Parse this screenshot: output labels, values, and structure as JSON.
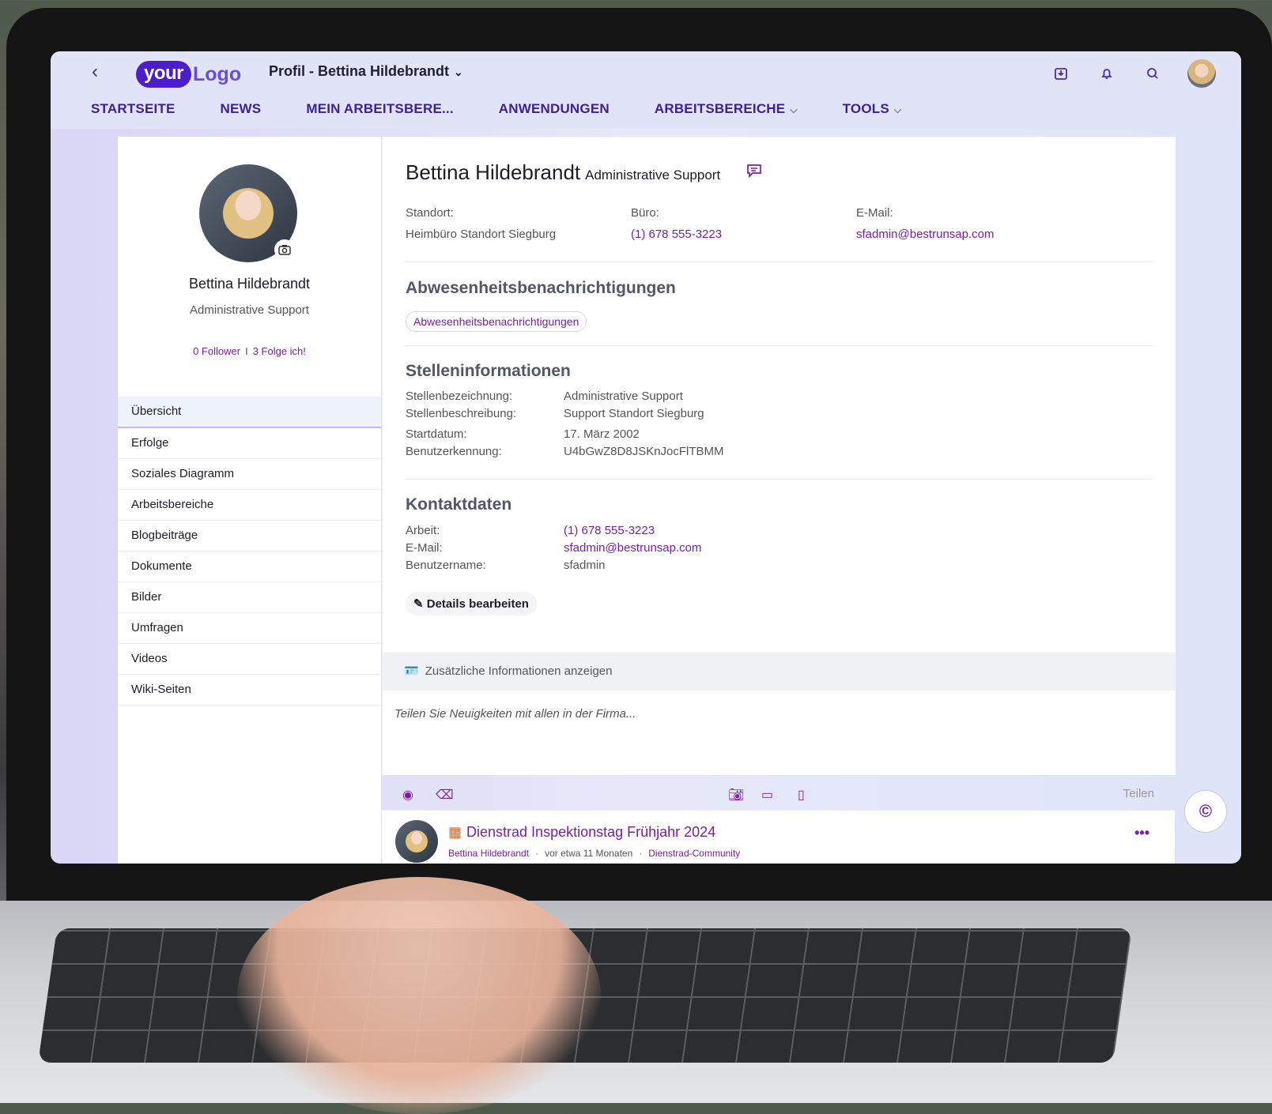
{
  "header": {
    "back_label": "‹",
    "logo_your": "your",
    "logo_text": "Logo",
    "page_title": "Profil - Bettina Hildebrandt",
    "icons": [
      "inbox-download-icon",
      "bell-icon",
      "search-icon",
      "user-avatar"
    ]
  },
  "nav": {
    "items": [
      {
        "label": "STARTSEITE",
        "has_dropdown": false
      },
      {
        "label": "NEWS",
        "has_dropdown": false
      },
      {
        "label": "MEIN ARBEITSBERE...",
        "has_dropdown": false
      },
      {
        "label": "ANWENDUNGEN",
        "has_dropdown": false
      },
      {
        "label": "ARBEITSBEREICHE",
        "has_dropdown": true
      },
      {
        "label": "TOOLS",
        "has_dropdown": true
      }
    ]
  },
  "profile_sidebar": {
    "name": "Bettina Hildebrandt",
    "role": "Administrative Support",
    "followers": "0 Follower",
    "separator": "I",
    "following": "3 Folge ich!",
    "menu": [
      "Übersicht",
      "Erfolge",
      "Soziales Diagramm",
      "Arbeitsbereiche",
      "Blogbeiträge",
      "Dokumente",
      "Bilder",
      "Umfragen",
      "Videos",
      "Wiki-Seiten"
    ],
    "active_item": "Übersicht"
  },
  "profile_main": {
    "name": "Bettina Hildebrandt",
    "role": "Administrative Support",
    "location_label": "Standort:",
    "location_value": "Heimbüro Standort Siegburg",
    "office_label": "Büro:",
    "office_value": "(1) 678 555-3223",
    "email_label": "E-Mail:",
    "email_value": "sfadmin@bestrunsap.com",
    "absence": {
      "heading": "Abwesenheitsbenachrichtigungen",
      "chip": "Abwesenheitsbenachrichtigungen"
    },
    "job": {
      "heading": "Stelleninformationen",
      "rows": [
        {
          "k": "Stellenbezeichnung:",
          "v": "Administrative Support"
        },
        {
          "k": "Stellenbeschreibung:",
          "v": "Support Standort Siegburg"
        },
        {
          "k": "Startdatum:",
          "v": "17. März 2002"
        },
        {
          "k": "Benutzerkennung:",
          "v": "U4bGwZ8D8JSKnJocFlTBMM"
        }
      ]
    },
    "contact": {
      "heading": "Kontaktdaten",
      "rows": [
        {
          "k": "Arbeit:",
          "v": "(1) 678 555-3223"
        },
        {
          "k": "E-Mail:",
          "v": "sfadmin@bestrunsap.com"
        },
        {
          "k": "Benutzername:",
          "v": "sfadmin"
        }
      ]
    },
    "edit_button": "Details bearbeiten",
    "more_info": "Zusätzliche Informationen anzeigen"
  },
  "share": {
    "placeholder": "Teilen Sie Neuigkeiten mit allen in der Firma...",
    "button": "Teilen"
  },
  "feed": {
    "title": "Dienstrad Inspektionstag Frühjahr 2024",
    "author": "Bettina Hildebrandt",
    "time": "vor etwa 11 Monaten",
    "community": "Dienstrad-Community",
    "meta_separator": "·",
    "more": "•••"
  },
  "fab_label": "©",
  "colors": {
    "accent": "#7a1fa0",
    "nav_text": "#3b1f9b",
    "logo_primary": "#4b1ec8"
  }
}
